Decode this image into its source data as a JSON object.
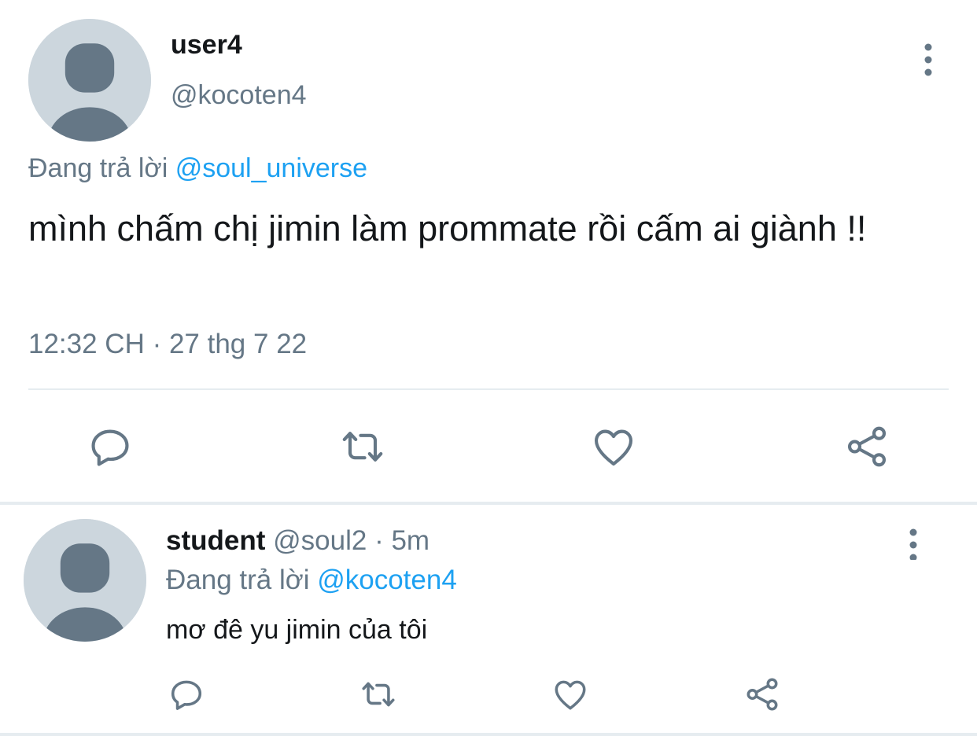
{
  "main_tweet": {
    "display_name": "user4",
    "handle": "@kocoten4",
    "replying_prefix": "Đang trả lời",
    "replying_to": "@soul_universe",
    "text": "mình chấm chị jimin làm prommate rồi cấm ai giành !!",
    "timestamp": "12:32 CH · 27 thg 7 22",
    "actions": [
      "reply-icon",
      "retweet-icon",
      "like-icon",
      "share-icon"
    ]
  },
  "reply_tweet": {
    "display_name": "student",
    "handle": "@soul2",
    "separator": "·",
    "time": "5m",
    "replying_prefix": "Đang trả lời",
    "replying_to": "@kocoten4",
    "text": "mơ đê yu jimin của tôi",
    "actions": [
      "reply-icon",
      "retweet-icon",
      "like-icon",
      "share-icon"
    ]
  },
  "colors": {
    "text": "#14171a",
    "secondary": "#657786",
    "accent": "#1da1f2",
    "avatar_bg": "#ccd6dd",
    "avatar_fg": "#657786",
    "divider": "#e6ecf0"
  }
}
